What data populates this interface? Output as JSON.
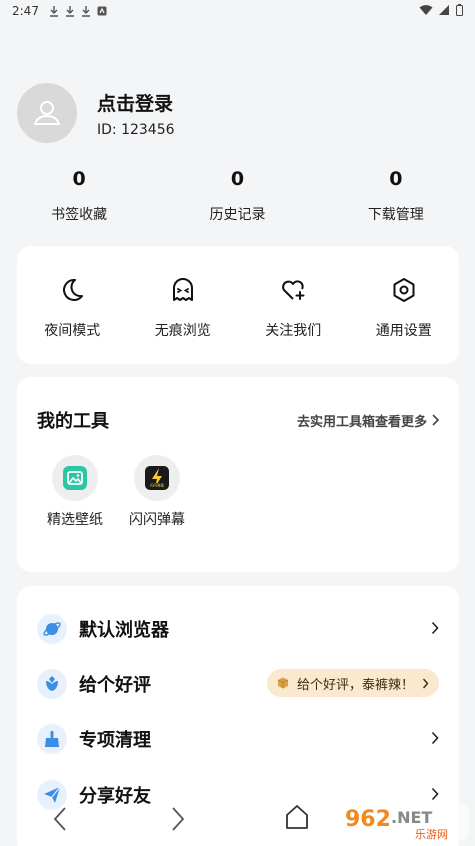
{
  "status_bar": {
    "time": "2:47"
  },
  "profile": {
    "login_text": "点击登录",
    "user_id": "ID: 123456"
  },
  "stats": [
    {
      "value": "0",
      "label": "书签收藏"
    },
    {
      "value": "0",
      "label": "历史记录"
    },
    {
      "value": "0",
      "label": "下载管理"
    }
  ],
  "features": [
    {
      "label": "夜间模式",
      "icon": "moon-icon"
    },
    {
      "label": "无痕浏览",
      "icon": "ghost-icon"
    },
    {
      "label": "关注我们",
      "icon": "heart-plus-icon"
    },
    {
      "label": "通用设置",
      "icon": "settings-icon"
    }
  ],
  "tools": {
    "title": "我的工具",
    "more_link": "去实用工具箱查看更多",
    "items": [
      {
        "label": "精选壁纸",
        "icon": "wallpaper-icon"
      },
      {
        "label": "闪闪弹幕",
        "icon": "lightning-icon"
      }
    ]
  },
  "menu": {
    "items": [
      {
        "label": "默认浏览器",
        "icon": "planet-icon"
      },
      {
        "label": "给个好评",
        "icon": "flower-icon",
        "promo": "给个好评，泰裤辣！"
      },
      {
        "label": "专项清理",
        "icon": "broom-icon"
      },
      {
        "label": "分享好友",
        "icon": "paper-plane-icon"
      }
    ]
  },
  "colors": {
    "accent_blue": "#3a8ee6",
    "promo_bg": "#fbe9cf",
    "background": "#f4f5f7"
  }
}
